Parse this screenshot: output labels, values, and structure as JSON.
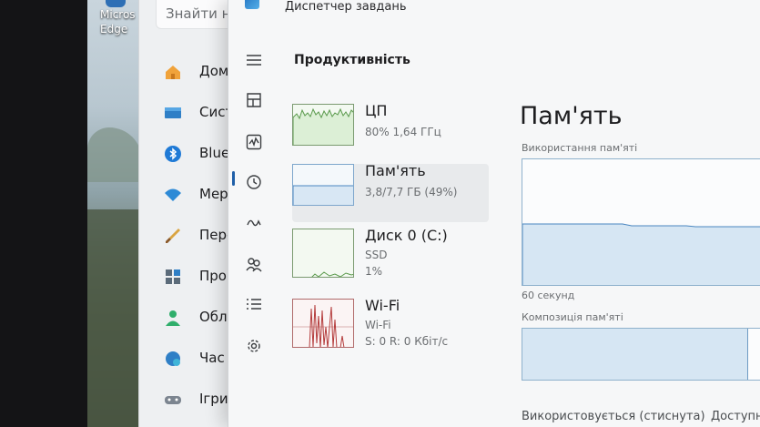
{
  "desktop": {
    "icon_label": "Micros\nEdge"
  },
  "settings": {
    "search_placeholder": "Знайти на",
    "items": [
      {
        "label": "Дом",
        "icon": "home-icon"
      },
      {
        "label": "Сист",
        "icon": "system-icon"
      },
      {
        "label": "Blue",
        "icon": "bluetooth-icon"
      },
      {
        "label": "Мер",
        "icon": "network-icon"
      },
      {
        "label": "Перс",
        "icon": "personalization-icon"
      },
      {
        "label": "Про",
        "icon": "apps-icon"
      },
      {
        "label": "Облі",
        "icon": "accounts-icon"
      },
      {
        "label": "Час",
        "icon": "time-icon"
      },
      {
        "label": "Ігри",
        "icon": "gaming-icon"
      }
    ]
  },
  "task_manager": {
    "title": "Диспетчер завдань",
    "section_title": "Продуктивність",
    "rail": [
      "menu-icon",
      "processes-icon",
      "performance-icon",
      "app-history-icon",
      "startup-icon",
      "users-icon",
      "details-icon",
      "services-icon"
    ],
    "cards": [
      {
        "name": "ЦП",
        "line1": "80%  1,64 ГГц",
        "line2": "",
        "line3": ""
      },
      {
        "name": "Пам'ять",
        "line1": "3,8/7,7 ГБ (49%)",
        "line2": "",
        "line3": ""
      },
      {
        "name": "Диск 0 (C:)",
        "line1": "SSD",
        "line2": "1%",
        "line3": ""
      },
      {
        "name": "Wi-Fi",
        "line1": "Wi-Fi",
        "line2": "S: 0  R: 0 Кбіт/с",
        "line3": ""
      }
    ],
    "detail": {
      "title": "Пам'ять",
      "usage_caption": "Використання пам'яті",
      "time_caption": "60 секунд",
      "composition_caption": "Композиція пам'яті",
      "in_use_label": "Використовується (стиснута)",
      "available_label": "Доступн",
      "usage_fraction": 0.49,
      "composition_in_use_fraction": 0.92
    }
  },
  "colors": {
    "accent": "#1f5fa8",
    "cpu_line": "#5a9a4c",
    "memory_line": "#4a86c0",
    "disk_line": "#5a9a4c",
    "wifi_line": "#b43b3b"
  }
}
